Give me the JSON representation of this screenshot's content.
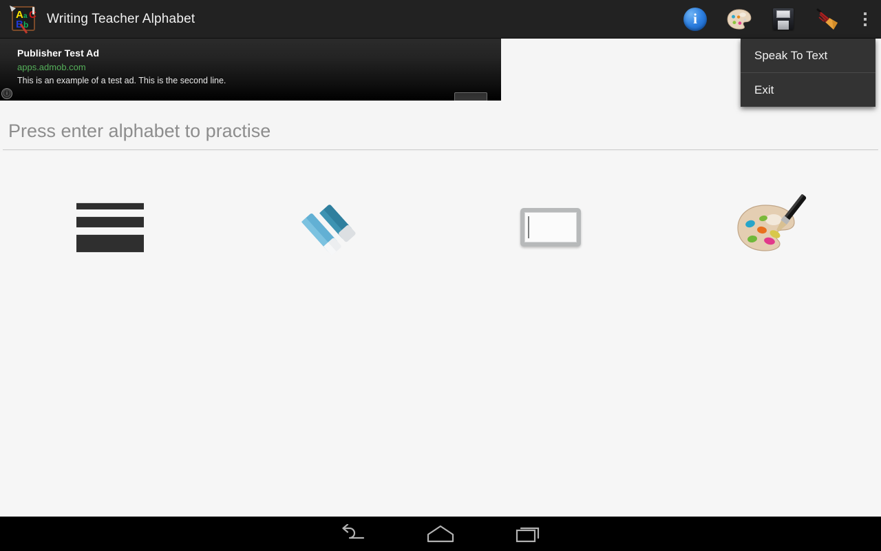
{
  "action_bar": {
    "app_icon_name": "app-icon-abc-blackboard",
    "title": "Writing Teacher Alphabet",
    "actions": [
      {
        "name": "info-icon",
        "label": "Info"
      },
      {
        "name": "palette-icon",
        "label": "Colour"
      },
      {
        "name": "save-icon",
        "label": "Save"
      },
      {
        "name": "marker-icon",
        "label": "Pen"
      },
      {
        "name": "overflow-icon",
        "label": "More options"
      }
    ]
  },
  "overflow_menu": {
    "items": [
      {
        "label": "Speak To Text"
      },
      {
        "label": "Exit"
      }
    ]
  },
  "ad": {
    "headline": "Publisher Test Ad",
    "url": "apps.admob.com",
    "body": "This is an example of a test ad. This is the second line.",
    "cta_icon": "right-arrow-icon",
    "info_badge": "ⓘ"
  },
  "entry": {
    "value": "",
    "placeholder": "Press enter alphabet to practise"
  },
  "tools": [
    {
      "name": "stroke-thickness-tool",
      "label": "Stroke thickness"
    },
    {
      "name": "eraser-tool",
      "label": "Eraser"
    },
    {
      "name": "board-tool",
      "label": "Board"
    },
    {
      "name": "palette-tool",
      "label": "Palette"
    }
  ],
  "nav_bar": {
    "buttons": [
      {
        "name": "nav-back-button",
        "label": "Back"
      },
      {
        "name": "nav-home-button",
        "label": "Home"
      },
      {
        "name": "nav-recents-button",
        "label": "Recents"
      }
    ]
  },
  "colors": {
    "action_bar_bg": "#222222",
    "menu_bg": "#333333",
    "canvas_bg": "#f6f6f6",
    "ad_url_green": "#55b05a",
    "info_blue": "#2d7fe0",
    "nav_bg": "#000000"
  }
}
